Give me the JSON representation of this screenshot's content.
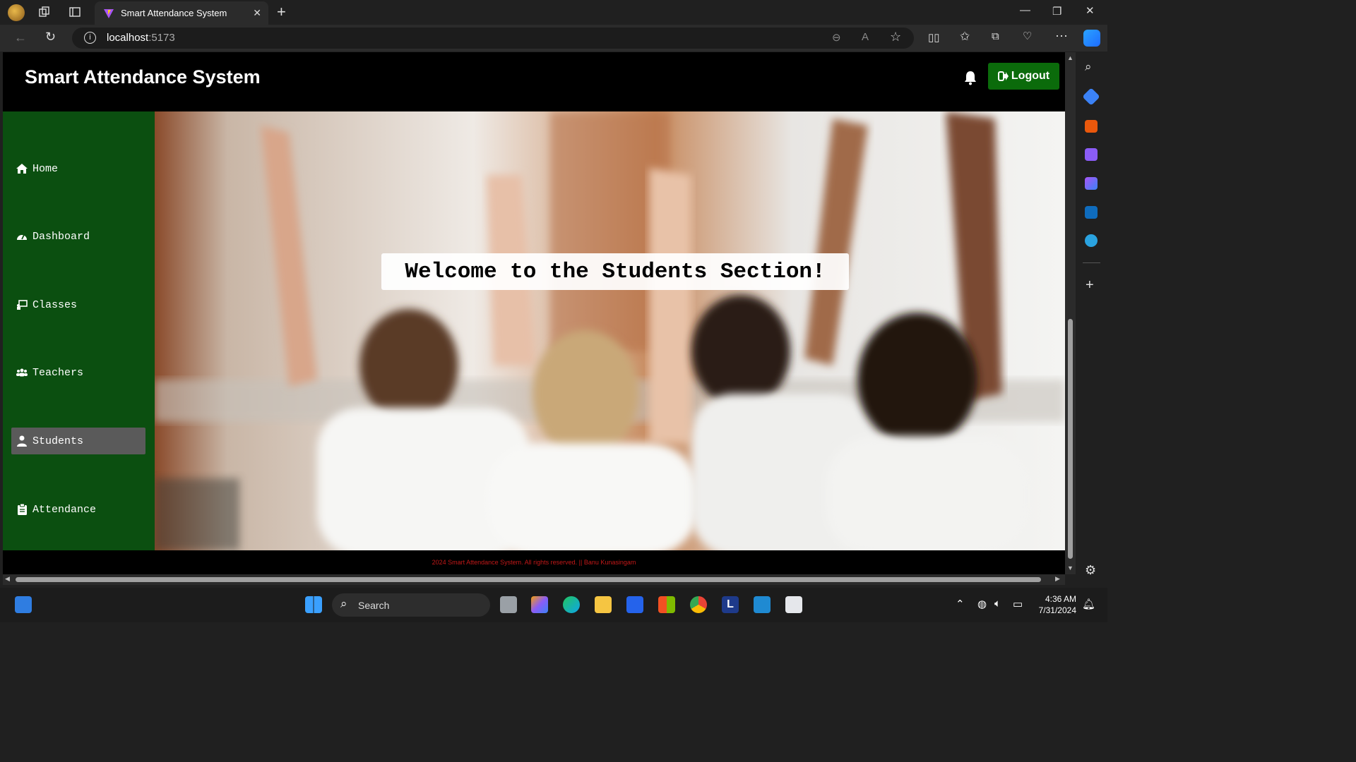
{
  "browser": {
    "tab_title": "Smart Attendance System",
    "url_host": "localhost",
    "url_port": ":5173"
  },
  "app": {
    "title": "Smart Attendance System",
    "logout_label": "Logout"
  },
  "sidebar": {
    "items": [
      {
        "label": "Home",
        "icon": "home-icon"
      },
      {
        "label": "Dashboard",
        "icon": "dashboard-icon"
      },
      {
        "label": "Classes",
        "icon": "classes-icon"
      },
      {
        "label": "Teachers",
        "icon": "teachers-icon"
      },
      {
        "label": "Students",
        "icon": "student-icon",
        "active": true
      },
      {
        "label": "Attendance",
        "icon": "clipboard-icon"
      }
    ]
  },
  "main": {
    "welcome": "Welcome to the Students Section!"
  },
  "footer": {
    "text": "2024 Smart Attendance System. All rights reserved. || Banu Kunasingam"
  },
  "taskbar": {
    "search_label": "Search",
    "time": "4:36 AM",
    "date": "7/31/2024"
  },
  "colors": {
    "sidebar_bg": "#0b4f10",
    "logout_bg": "#0b6b0b",
    "footer_text": "#c31818",
    "active_item": "#5a5a5a"
  }
}
